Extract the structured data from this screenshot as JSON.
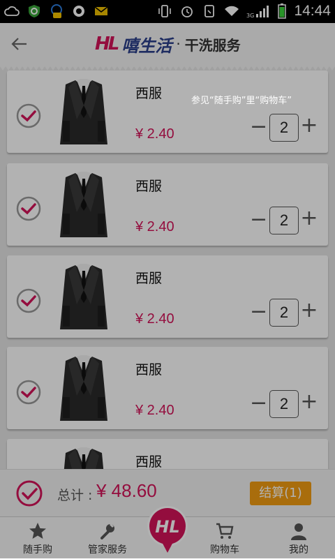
{
  "status_bar": {
    "time": "14:44",
    "network": "3G"
  },
  "header": {
    "logo_mark": "HL",
    "brand_name": "嘻生活",
    "brand_dot": "·",
    "brand_sub": "干洗服务"
  },
  "items": [
    {
      "name": "西服",
      "price": "¥ 2.40",
      "qty": "2",
      "checked": true
    },
    {
      "name": "西服",
      "price": "¥ 2.40",
      "qty": "2",
      "checked": true
    },
    {
      "name": "西服",
      "price": "¥ 2.40",
      "qty": "2",
      "checked": true
    },
    {
      "name": "西服",
      "price": "¥ 2.40",
      "qty": "2",
      "checked": true
    },
    {
      "name": "西服",
      "price": "",
      "qty": "",
      "checked": false
    }
  ],
  "controls": {
    "minus": "−",
    "plus": "+"
  },
  "summary": {
    "total_label": "总计 :",
    "total_value": "¥ 48.60",
    "checkout_label": "结算(1)"
  },
  "tabs": [
    {
      "label": "随手购",
      "icon": "star-icon"
    },
    {
      "label": "管家服务",
      "icon": "wrench-icon"
    },
    {
      "label": "",
      "icon": "hl-logo-icon"
    },
    {
      "label": "购物车",
      "icon": "cart-icon"
    },
    {
      "label": "我的",
      "icon": "user-icon"
    }
  ],
  "overlay_hint": "参见“随手购”里“购物车”",
  "colors": {
    "accent": "#d4145a",
    "checkout": "#f39c12",
    "brand_blue": "#2b3f8c"
  }
}
